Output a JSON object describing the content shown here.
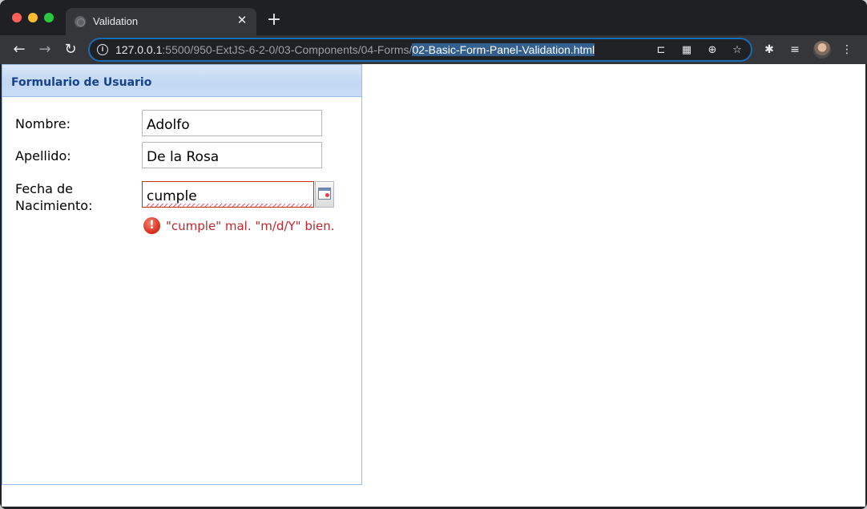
{
  "browser": {
    "tab": {
      "title": "Validation",
      "close": "✕"
    },
    "new_tab": "+",
    "nav": {
      "back": "←",
      "forward": "→",
      "reload": "↻"
    },
    "url": {
      "host": "127.0.0.1",
      "path": ":5500/950-ExtJS-6-2-0/03-Components/04-Forms/",
      "selected": "02-Basic-Form-Panel-Validation.html"
    },
    "omnibox_icons": {
      "info": "i",
      "cast": "⊏",
      "qr": "▦",
      "zoom": "⊕",
      "bookmark": "☆"
    },
    "toolbar_icons": {
      "extensions": "✱",
      "media": "≡",
      "menu": "⋮"
    }
  },
  "form": {
    "title": "Formulario de Usuario",
    "fields": [
      {
        "label": "Nombre:",
        "value": "Adolfo"
      },
      {
        "label": "Apellido:",
        "value": "De la Rosa"
      },
      {
        "label_line1": "Fecha de",
        "label_line2": "Nacimiento:",
        "value": "cumple"
      }
    ],
    "error": {
      "icon": "!",
      "message": "\"cumple\" mal. \"m/d/Y\" bien."
    }
  },
  "colors": {
    "error": "#c0272d",
    "panel_title": "#15428b",
    "panel_border": "#99bbe8",
    "selection": "#335f8f"
  }
}
